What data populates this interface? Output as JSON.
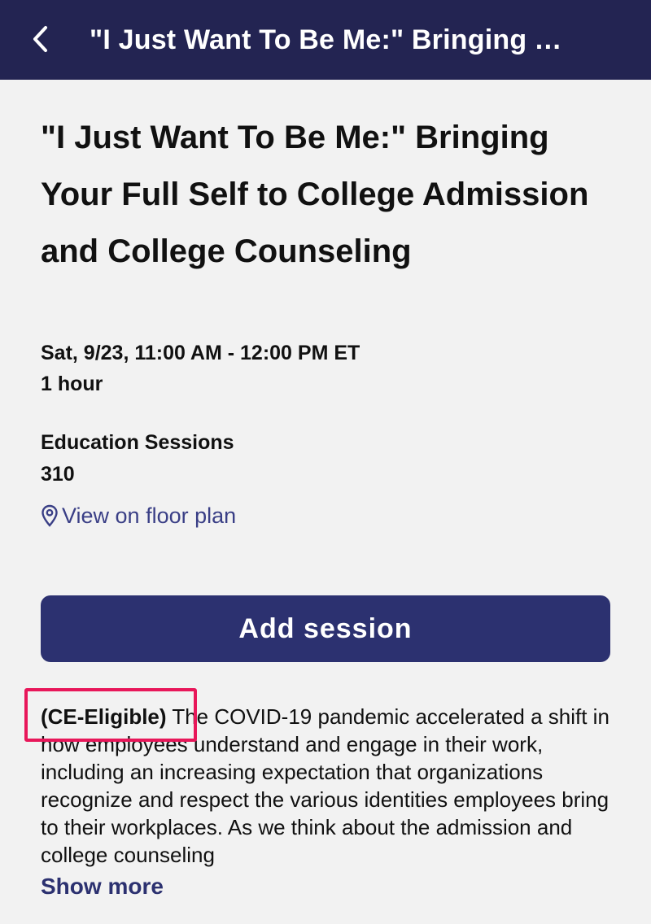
{
  "navbar": {
    "back_icon": "chevron-left-icon",
    "title": "\"I Just Want To Be Me:\" Bringing Your Full Self to College Admission and College Counseling"
  },
  "session": {
    "title": "\"I Just Want To Be Me:\" Bringing Your Full Self to College Admission and College Counseling",
    "time": "Sat, 9/23, 11:00 AM - 12:00 PM ET",
    "duration": "1 hour",
    "track": "Education Sessions",
    "room": "310",
    "floorplan_icon": "map-pin-icon",
    "floorplan_label": "View on floor plan"
  },
  "actions": {
    "add_label": "Add session"
  },
  "description": {
    "tag": "(CE-Eligible)",
    "text": " The COVID-19 pandemic accelerated a shift in how employees understand and engage in their work, including an increasing expectation that organizations recognize and respect the various identities employees bring to their workplaces. As we think about the admission and college counseling",
    "show_more_label": "Show more"
  },
  "colors": {
    "navbar_bg": "#232452",
    "accent": "#2c3170",
    "link": "#3a3f86",
    "highlight": "#e8175a",
    "page_bg": "#f2f2f2"
  }
}
